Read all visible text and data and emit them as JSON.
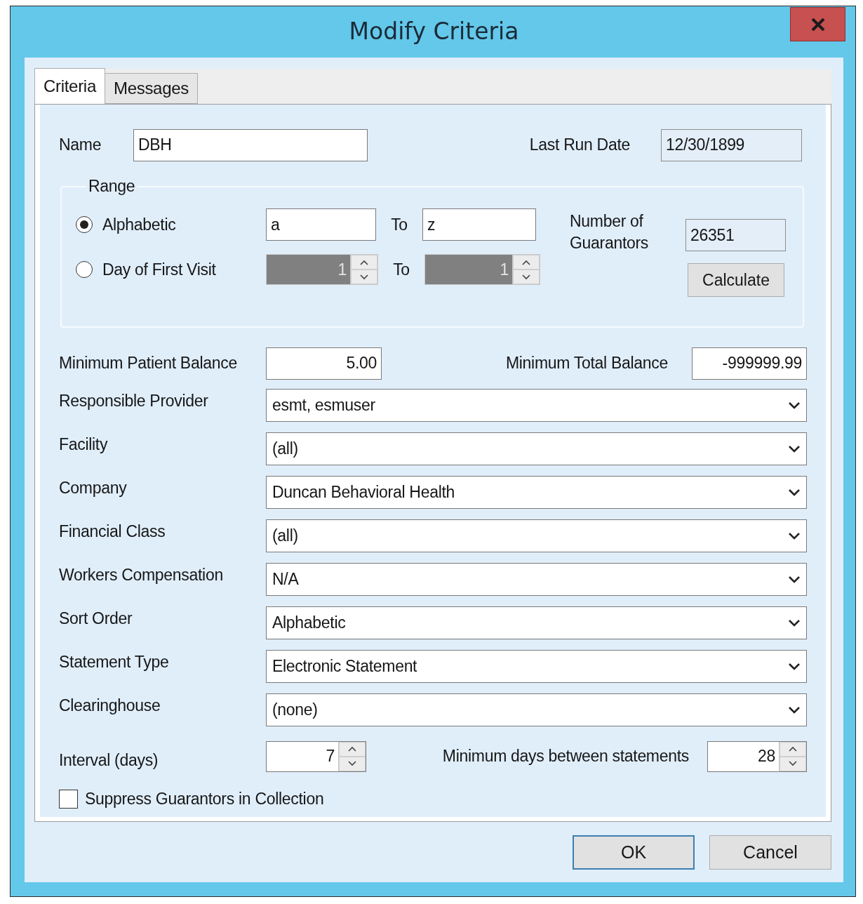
{
  "window": {
    "title": "Modify Criteria"
  },
  "tabs": [
    {
      "label": "Criteria",
      "selected": true
    },
    {
      "label": "Messages",
      "selected": false
    }
  ],
  "name": {
    "label": "Name",
    "value": "DBH"
  },
  "last_run_date": {
    "label": "Last Run Date",
    "value": "12/30/1899"
  },
  "range": {
    "title": "Range",
    "options": [
      {
        "kind": "text",
        "label": "Alphabetic",
        "selected": true,
        "disabled": false,
        "from": "a",
        "to_label": "To",
        "to": "z"
      },
      {
        "kind": "spinner",
        "label": "Day of First Visit",
        "selected": false,
        "disabled": true,
        "from": "1",
        "to_label": "To",
        "to": "1"
      }
    ],
    "guarantors_label": "Number of Guarantors",
    "guarantors_value": "26351",
    "calculate_button": "Calculate"
  },
  "min_patient_balance": {
    "label": "Minimum Patient Balance",
    "value": "5.00"
  },
  "min_total_balance": {
    "label": "Minimum Total Balance",
    "value": "-999999.99"
  },
  "dropdowns": [
    {
      "label": "Responsible Provider",
      "value": "esmt, esmuser"
    },
    {
      "label": "Facility",
      "value": "(all)"
    },
    {
      "label": "Company",
      "value": "Duncan Behavioral Health"
    },
    {
      "label": "Financial Class",
      "value": "(all)"
    },
    {
      "label": "Workers Compensation",
      "value": "N/A"
    },
    {
      "label": "Sort Order",
      "value": "Alphabetic"
    },
    {
      "label": "Statement Type",
      "value": "Electronic Statement"
    },
    {
      "label": "Clearinghouse",
      "value": "(none)"
    }
  ],
  "interval": {
    "label": "Interval (days)",
    "value": "7"
  },
  "min_days": {
    "label": "Minimum days between statements",
    "value": "28"
  },
  "suppress": {
    "label": "Suppress Guarantors in Collection",
    "checked": false
  },
  "buttons": [
    {
      "label": "OK",
      "default": true
    },
    {
      "label": "Cancel",
      "default": false
    }
  ]
}
